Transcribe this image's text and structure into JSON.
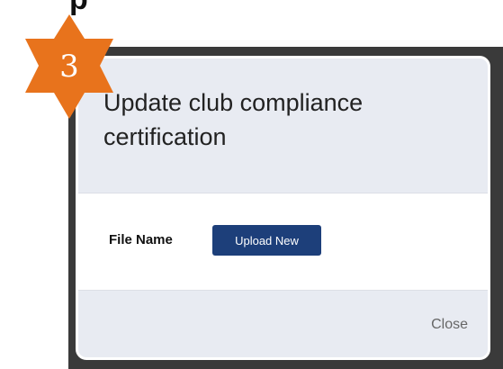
{
  "header_text": "p",
  "badge": {
    "number": "3",
    "color": "#e8731c"
  },
  "dialog": {
    "title": "Update club compliance certification",
    "file_label": "File Name",
    "upload_label": "Upload New",
    "close_label": "Close"
  },
  "colors": {
    "accent_button": "#1d3f7a",
    "header_bg": "#e8ebf2",
    "backdrop": "#3a3a3a"
  }
}
